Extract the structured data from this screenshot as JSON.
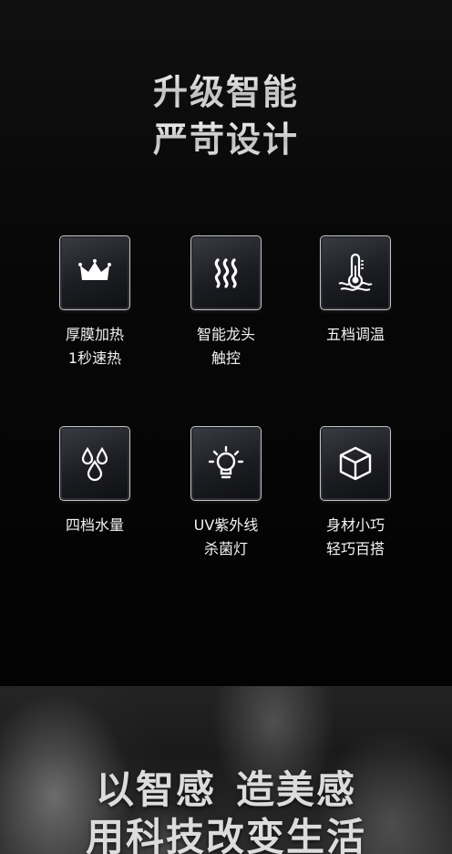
{
  "hero": {
    "line1": "升级智能",
    "line2": "严苛设计"
  },
  "features": [
    {
      "icon": "crown-icon",
      "label1": "厚膜加热",
      "label2": "1秒速热"
    },
    {
      "icon": "heat-waves-icon",
      "label1": "智能龙头",
      "label2": "触控"
    },
    {
      "icon": "thermometer-icon",
      "label1": "五档调温",
      "label2": ""
    },
    {
      "icon": "water-drops-icon",
      "label1": "四档水量",
      "label2": ""
    },
    {
      "icon": "lightbulb-icon",
      "label1": "UV紫外线",
      "label2": "杀菌灯"
    },
    {
      "icon": "cube-icon",
      "label1": "身材小巧",
      "label2": "轻巧百搭"
    }
  ],
  "banner": {
    "line1a": "以智感",
    "line1b": "造美感",
    "line2": "用科技改变生活"
  }
}
